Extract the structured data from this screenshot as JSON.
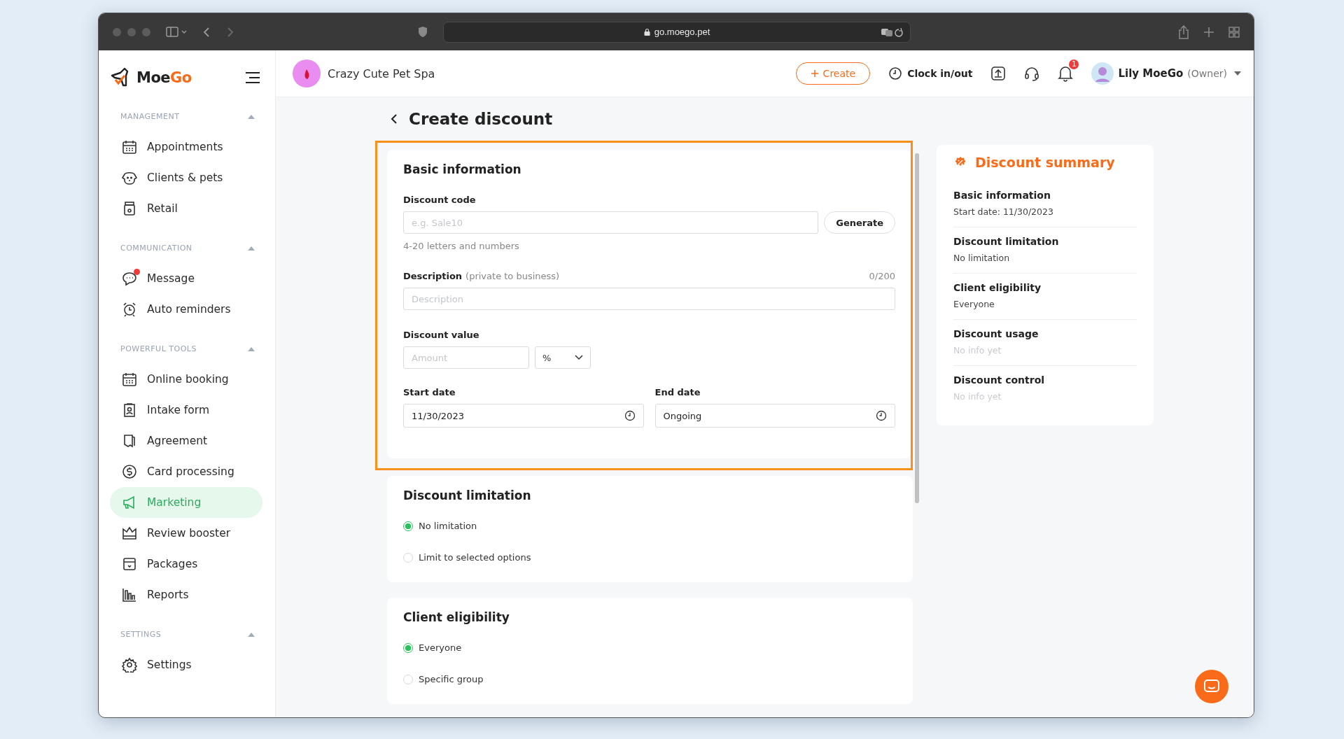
{
  "browser": {
    "url": "go.moego.pet"
  },
  "sidebar": {
    "brand": {
      "first": "Moe",
      "second": "Go"
    },
    "groups": [
      {
        "title": "MANAGEMENT",
        "expanded": true,
        "items": [
          {
            "label": "Appointments",
            "selected": false,
            "notification_dot": false
          },
          {
            "label": "Clients & pets",
            "selected": false,
            "notification_dot": false
          },
          {
            "label": "Retail",
            "selected": false,
            "notification_dot": false
          }
        ]
      },
      {
        "title": "COMMUNICATION",
        "expanded": true,
        "items": [
          {
            "label": "Message",
            "selected": false,
            "notification_dot": true
          },
          {
            "label": "Auto reminders",
            "selected": false,
            "notification_dot": false
          }
        ]
      },
      {
        "title": "POWERFUL TOOLS",
        "expanded": true,
        "items": [
          {
            "label": "Online booking",
            "selected": false,
            "notification_dot": false
          },
          {
            "label": "Intake form",
            "selected": false,
            "notification_dot": false
          },
          {
            "label": "Agreement",
            "selected": false,
            "notification_dot": false
          },
          {
            "label": "Card processing",
            "selected": false,
            "notification_dot": false
          },
          {
            "label": "Marketing",
            "selected": true,
            "notification_dot": false
          },
          {
            "label": "Review booster",
            "selected": false,
            "notification_dot": false
          },
          {
            "label": "Packages",
            "selected": false,
            "notification_dot": false
          },
          {
            "label": "Reports",
            "selected": false,
            "notification_dot": false
          }
        ]
      },
      {
        "title": "SETTINGS",
        "expanded": true,
        "items": [
          {
            "label": "Settings",
            "selected": false,
            "notification_dot": false
          }
        ]
      }
    ]
  },
  "header": {
    "business": "Crazy Cute Pet Spa",
    "create_button": "Create",
    "clock": "Clock in/out",
    "notification_count": "1",
    "user": {
      "name": "Lily MoeGo",
      "role": "(Owner)"
    }
  },
  "page": {
    "title": "Create discount"
  },
  "basic_information": {
    "title": "Basic information",
    "highlighted": true,
    "discount_code": {
      "label": "Discount code",
      "placeholder": "e.g. Sale10",
      "button": "Generate",
      "hint": "4-20 letters and numbers"
    },
    "description": {
      "label": "Description",
      "note": "(private to business)",
      "counter": "0/200",
      "placeholder": "Description"
    },
    "discount_value": {
      "label": "Discount value",
      "placeholder": "Amount",
      "unit": "%"
    },
    "start_date": {
      "label": "Start date",
      "value": "11/30/2023"
    },
    "end_date": {
      "label": "End date",
      "value": "Ongoing"
    }
  },
  "option_sections": [
    {
      "title": "Discount limitation",
      "options": [
        {
          "label": "No limitation",
          "selected": true
        },
        {
          "label": "Limit to selected options",
          "selected": false
        }
      ]
    },
    {
      "title": "Client eligibility",
      "options": [
        {
          "label": "Everyone",
          "selected": true
        },
        {
          "label": "Specific group",
          "selected": false
        }
      ]
    }
  ],
  "summary": {
    "title": "Discount summary",
    "items": [
      {
        "title": "Basic information",
        "value": "Start date: 11/30/2023",
        "empty": false
      },
      {
        "title": "Discount limitation",
        "value": "No limitation",
        "empty": false
      },
      {
        "title": "Client eligibility",
        "value": "Everyone",
        "empty": false
      },
      {
        "title": "Discount usage",
        "value": "No info yet",
        "empty": true
      },
      {
        "title": "Discount control",
        "value": "No info yet",
        "empty": true
      }
    ]
  }
}
